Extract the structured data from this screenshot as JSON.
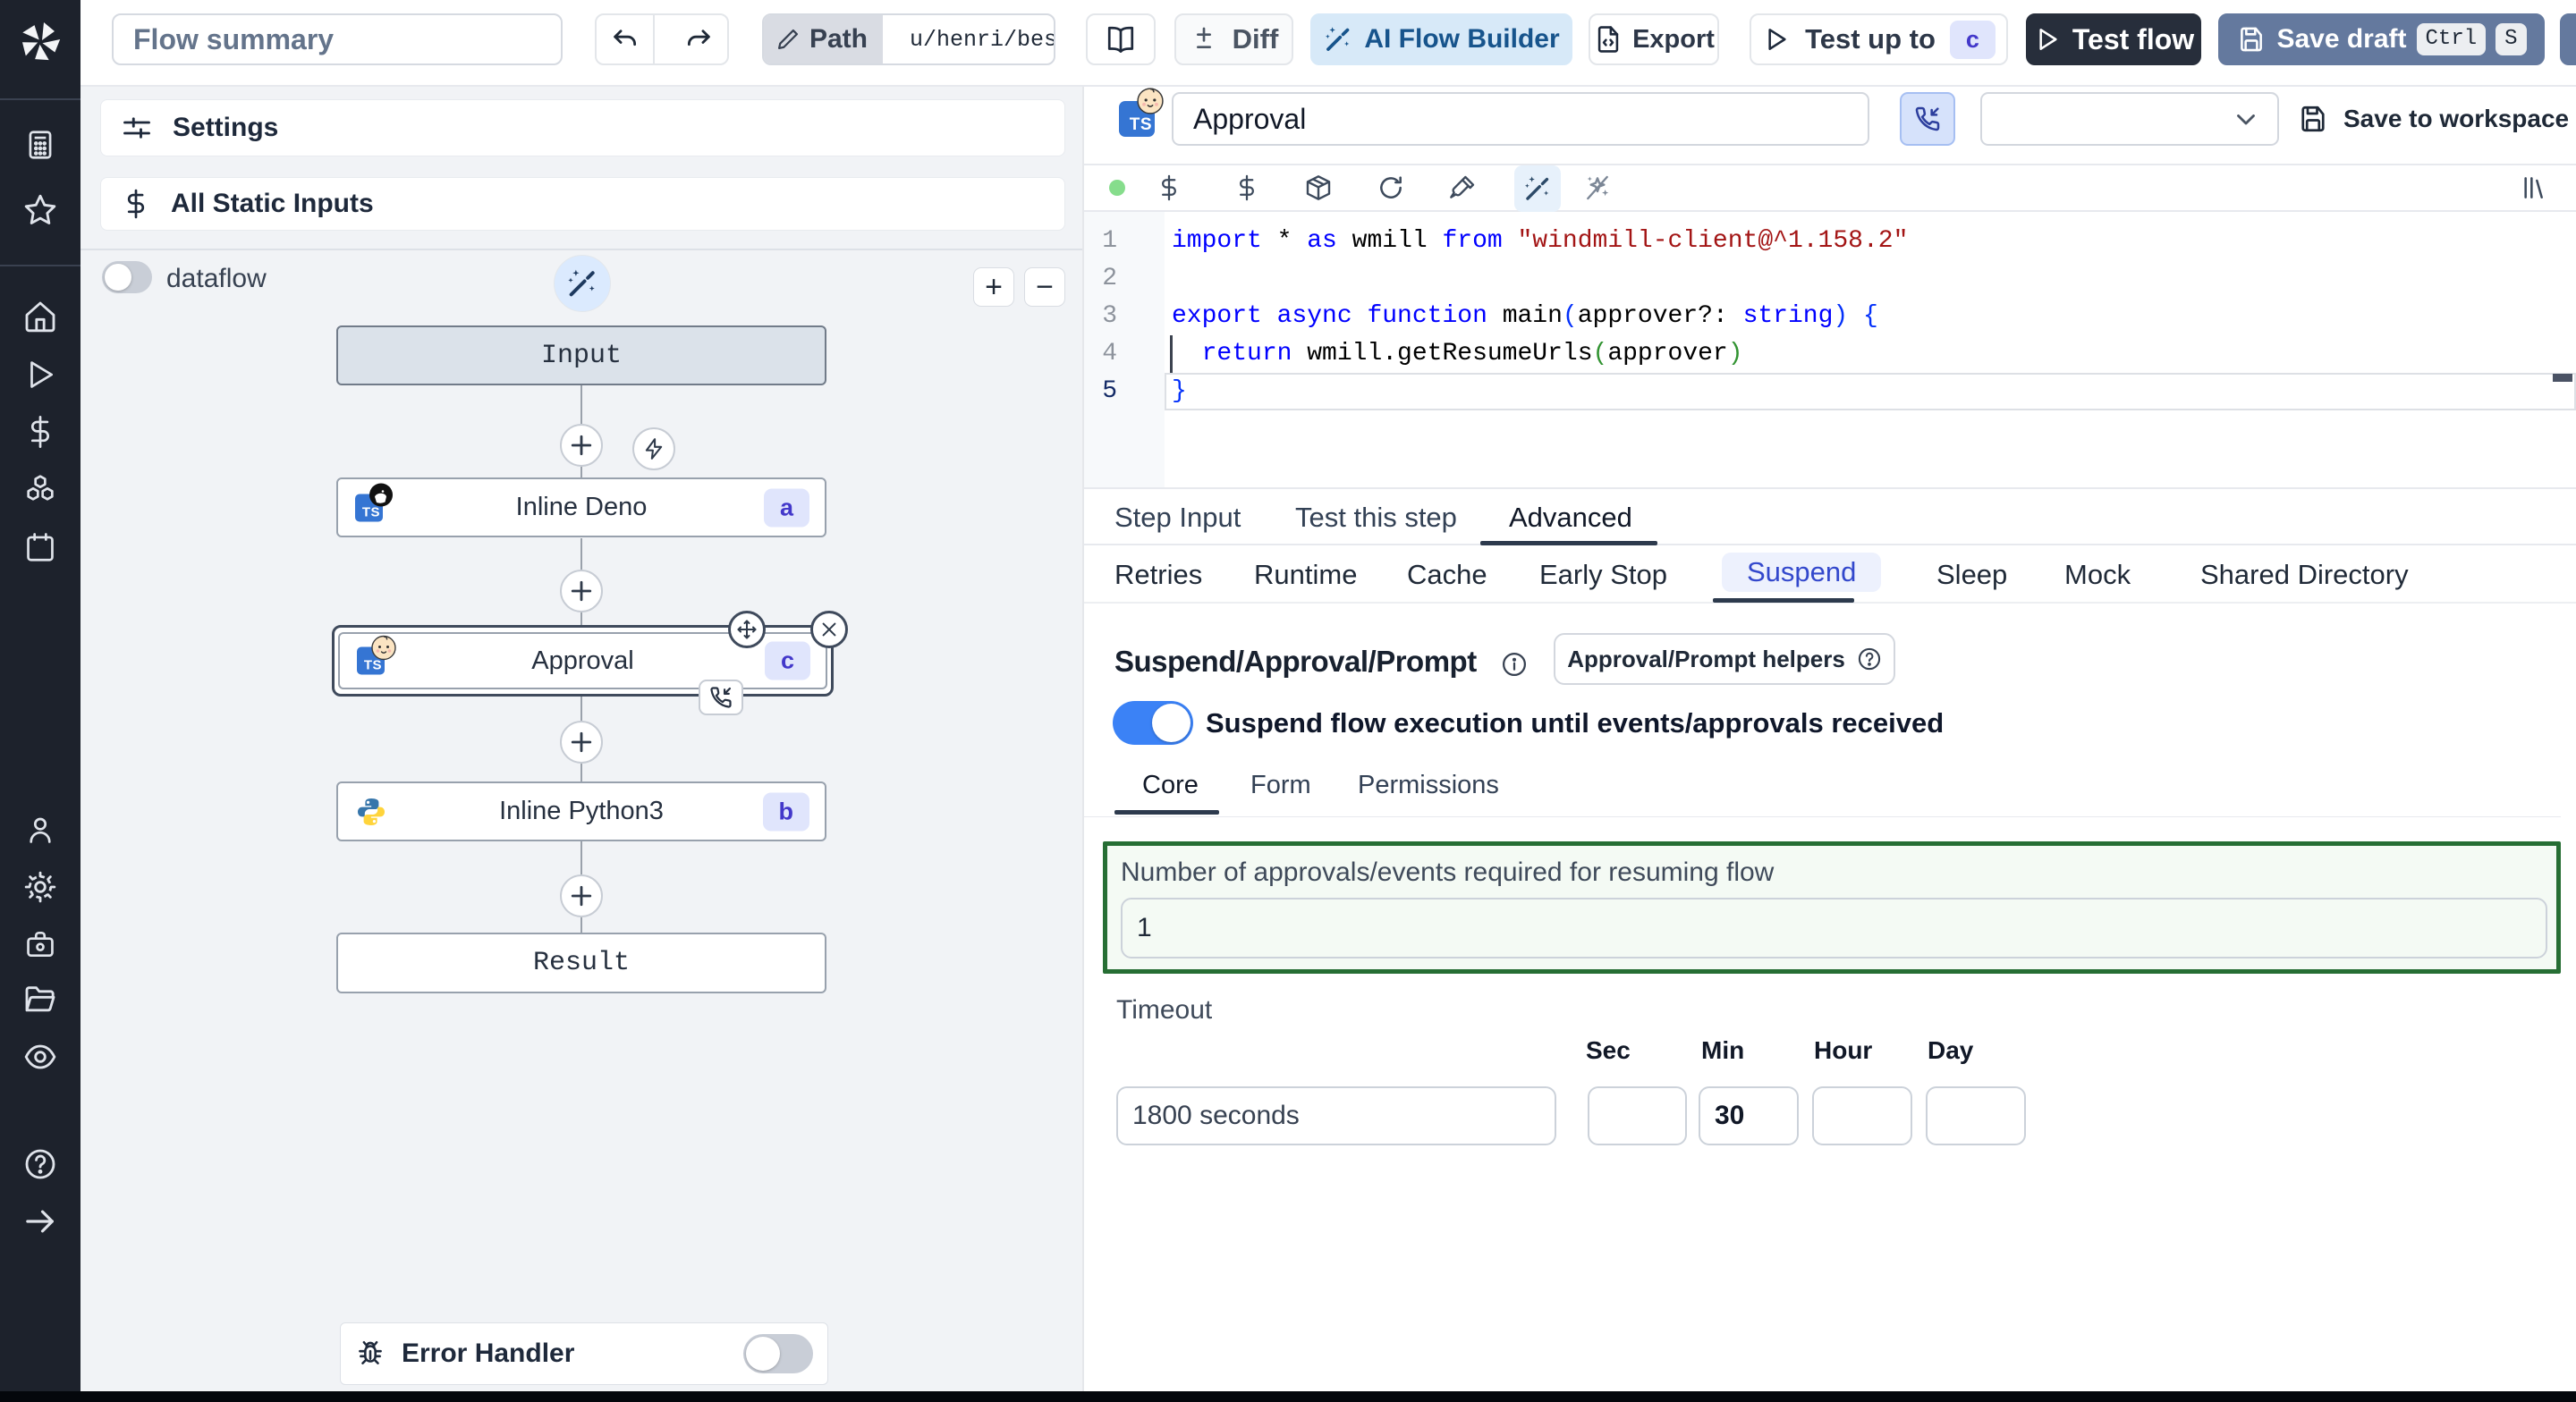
{
  "colors": {
    "sidebar_bg": "#1d222c",
    "accent_blue": "#3b82f6",
    "ai_chip_bg": "#d7e9f8",
    "dark_button": "#272e3b",
    "slate_button": "#64799e",
    "badge_bg": "#e0e5fc",
    "badge_text": "#4338ca",
    "green_border": "#266e34",
    "suspend_tab": "#3348cc"
  },
  "ts_logo_text": "TS",
  "sidebar": {
    "icons": [
      "windmill-logo",
      "apps-icon",
      "star-icon",
      "home-icon",
      "runs-icon",
      "variables-icon",
      "resources-icon",
      "schedules-icon",
      "user-icon",
      "settings-icon",
      "workers-icon",
      "folders-icon",
      "audit-logs-icon",
      "help-icon",
      "expand-icon"
    ]
  },
  "topbar": {
    "flow_summary_placeholder": "Flow summary",
    "path_label": "Path",
    "path_value": "u/henri/bes",
    "diff_label": "Diff",
    "ai_flow_builder_label": "AI Flow Builder",
    "export_label": "Export",
    "test_up_to_label": "Test up to",
    "test_up_to_badge": "c",
    "test_flow_label": "Test flow",
    "save_draft_label": "Save draft",
    "save_draft_keys": {
      "k1": "Ctrl",
      "k2": "S"
    }
  },
  "left_panel": {
    "settings_label": "Settings",
    "static_inputs_label": "All Static Inputs",
    "dataflow_label": "dataflow",
    "zoom_in": "+",
    "zoom_out": "−",
    "nodes": {
      "input": {
        "label": "Input"
      },
      "deno": {
        "label": "Inline Deno",
        "badge": "a"
      },
      "approval": {
        "label": "Approval",
        "badge": "c"
      },
      "python": {
        "label": "Inline Python3",
        "badge": "b"
      },
      "result": {
        "label": "Result"
      }
    },
    "error_handler_label": "Error Handler"
  },
  "right_panel": {
    "step_name_value": "Approval",
    "save_to_workspace_label": "Save to workspace",
    "editor": {
      "active_line": 5,
      "cursor_line": 4,
      "code": [
        [
          {
            "t": "import ",
            "c": "k"
          },
          {
            "t": "* ",
            "c": "p"
          },
          {
            "t": "as ",
            "c": "k"
          },
          {
            "t": "wmill ",
            "c": "p"
          },
          {
            "t": "from ",
            "c": "k"
          },
          {
            "t": "\"windmill-client@^1.158.2\"",
            "c": "s"
          }
        ],
        [],
        [
          {
            "t": "export ",
            "c": "k"
          },
          {
            "t": "async ",
            "c": "k"
          },
          {
            "t": "function ",
            "c": "k"
          },
          {
            "t": "main",
            "c": "p"
          },
          {
            "t": "(",
            "c": "b1"
          },
          {
            "t": "approver",
            "c": "p"
          },
          {
            "t": "?: ",
            "c": "p"
          },
          {
            "t": "string",
            "c": "k"
          },
          {
            "t": ")",
            "c": "b1"
          },
          {
            "t": " ",
            "c": "p"
          },
          {
            "t": "{",
            "c": "b1"
          }
        ],
        [
          {
            "t": "  ",
            "c": "p"
          },
          {
            "t": "return",
            "c": "k"
          },
          {
            "t": " wmill.getResumeUrls",
            "c": "p"
          },
          {
            "t": "(",
            "c": "b2"
          },
          {
            "t": "approver",
            "c": "p"
          },
          {
            "t": ")",
            "c": "b2"
          }
        ],
        [
          {
            "t": "}",
            "c": "b1"
          }
        ]
      ]
    },
    "tabs": {
      "t1": "Step Input",
      "t2": "Test this step",
      "t3": "Advanced"
    },
    "subtabs": {
      "s1": "Retries",
      "s2": "Runtime",
      "s3": "Cache",
      "s4": "Early Stop",
      "s5": "Suspend",
      "s6": "Sleep",
      "s7": "Mock",
      "s8": "Shared Directory"
    },
    "suspend": {
      "heading": "Suspend/Approval/Prompt",
      "helpers_button_label": "Approval/Prompt helpers",
      "toggle_label": "Suspend flow execution until events/approvals received",
      "core_tabs": {
        "c1": "Core",
        "c2": "Form",
        "c3": "Permissions"
      },
      "approvals_field_label": "Number of approvals/events required for resuming flow",
      "approvals_field_value": "1",
      "timeout_label": "Timeout",
      "timeout_value": "1800 seconds",
      "sec_label": "Sec",
      "min_label": "Min",
      "hour_label": "Hour",
      "day_label": "Day",
      "sec_value": "",
      "min_value": "30",
      "hour_value": "",
      "day_value": ""
    }
  }
}
